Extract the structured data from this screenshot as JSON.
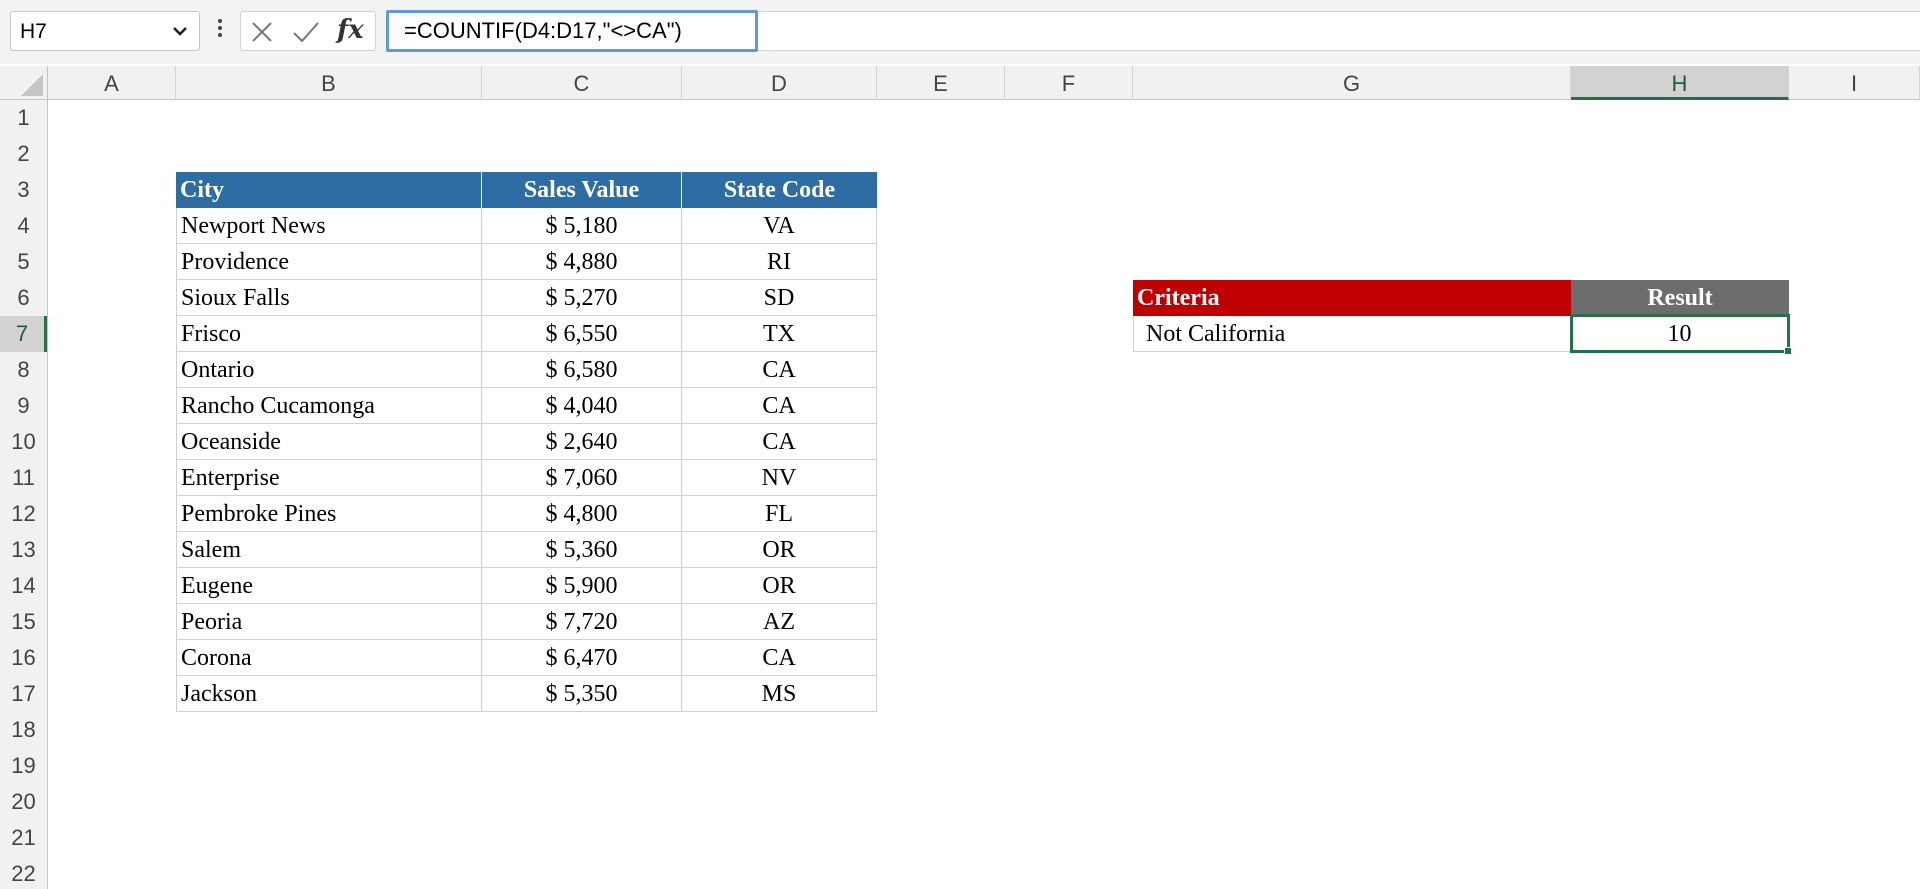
{
  "name_box": {
    "value": "H7"
  },
  "formula_bar": {
    "formula": "=COUNTIF(D4:D17,\"<>CA\")",
    "fx_label": "fx"
  },
  "columns": [
    "A",
    "B",
    "C",
    "D",
    "E",
    "F",
    "G",
    "H",
    "I"
  ],
  "rows": [
    "1",
    "2",
    "3",
    "4",
    "5",
    "6",
    "7",
    "8",
    "9",
    "10",
    "11",
    "12",
    "13",
    "14",
    "15",
    "16",
    "17",
    "18",
    "19",
    "20",
    "21",
    "22"
  ],
  "selected": {
    "column": "H",
    "row": "7"
  },
  "data_table": {
    "headers": [
      "City",
      "Sales Value",
      "State Code"
    ],
    "rows": [
      [
        "Newport News",
        "$ 5,180",
        "VA"
      ],
      [
        "Providence",
        "$ 4,880",
        "RI"
      ],
      [
        "Sioux Falls",
        "$ 5,270",
        "SD"
      ],
      [
        "Frisco",
        "$ 6,550",
        "TX"
      ],
      [
        "Ontario",
        "$ 6,580",
        "CA"
      ],
      [
        "Rancho Cucamonga",
        "$ 4,040",
        "CA"
      ],
      [
        "Oceanside",
        "$ 2,640",
        "CA"
      ],
      [
        "Enterprise",
        "$ 7,060",
        "NV"
      ],
      [
        "Pembroke Pines",
        "$ 4,800",
        "FL"
      ],
      [
        "Salem",
        "$ 5,360",
        "OR"
      ],
      [
        "Eugene",
        "$ 5,900",
        "OR"
      ],
      [
        "Peoria",
        "$ 7,720",
        "AZ"
      ],
      [
        "Corona",
        "$ 6,470",
        "CA"
      ],
      [
        "Jackson",
        "$ 5,350",
        "MS"
      ]
    ]
  },
  "result_table": {
    "criteria_header": "Criteria",
    "result_header": "Result",
    "criteria_value": "Not California",
    "result_value": "10"
  },
  "colors": {
    "table_header": "#2e6ca4",
    "criteria_header": "#c00000",
    "result_header": "#6d6d6d",
    "selection": "#217346"
  },
  "icons": [
    "chevron-down-icon",
    "more-options-icon",
    "cancel-icon",
    "enter-icon",
    "fx-icon"
  ]
}
